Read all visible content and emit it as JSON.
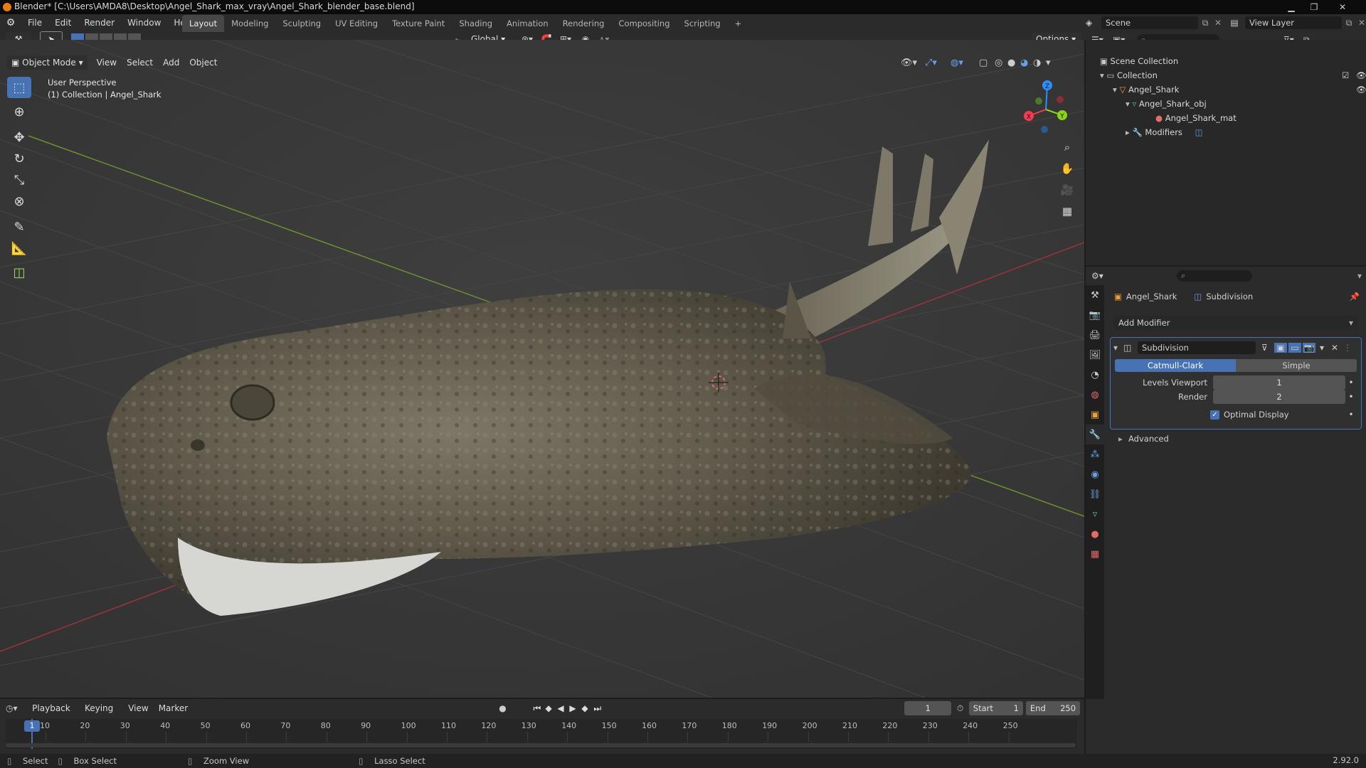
{
  "window": {
    "title": "Blender* [C:\\Users\\AMDA8\\Desktop\\Angel_Shark_max_vray\\Angel_Shark_blender_base.blend]"
  },
  "menu": [
    "File",
    "Edit",
    "Render",
    "Window",
    "Help"
  ],
  "workspaces": {
    "active": "Layout",
    "tabs": [
      "Layout",
      "Modeling",
      "Sculpting",
      "UV Editing",
      "Texture Paint",
      "Shading",
      "Animation",
      "Rendering",
      "Compositing",
      "Scripting"
    ],
    "add": "+"
  },
  "scene": {
    "label": "Scene"
  },
  "view_layer": {
    "label": "View Layer"
  },
  "toolbar_header": {
    "transform_orientation": "Global",
    "options": "Options"
  },
  "viewport": {
    "mode": "Object Mode",
    "menus": [
      "View",
      "Select",
      "Add",
      "Object"
    ],
    "overlay_line1": "User Perspective",
    "overlay_line2": "(1) Collection | Angel_Shark",
    "gizmo": {
      "x": "X",
      "y": "Y",
      "z": "Z"
    }
  },
  "outliner": {
    "scene_collection": "Scene Collection",
    "collection": "Collection",
    "object": "Angel_Shark",
    "mesh": "Angel_Shark_obj",
    "material": "Angel_Shark_mat",
    "modifiers": "Modifiers"
  },
  "properties": {
    "object_name": "Angel_Shark",
    "modifier_crumb": "Subdivision",
    "add_modifier": "Add Modifier",
    "modifier": {
      "name": "Subdivision",
      "mode_catmull": "Catmull-Clark",
      "mode_simple": "Simple",
      "active_mode": "Catmull-Clark",
      "levels_viewport_label": "Levels Viewport",
      "levels_viewport": "1",
      "render_label": "Render",
      "render": "2",
      "optimal_display_label": "Optimal Display",
      "optimal_display": true,
      "advanced": "Advanced"
    }
  },
  "timeline": {
    "menus": [
      "Playback",
      "Keying",
      "View",
      "Marker"
    ],
    "current_frame": "1",
    "start_label": "Start",
    "start": "1",
    "end_label": "End",
    "end": "250",
    "ticks": [
      "10",
      "20",
      "30",
      "40",
      "50",
      "60",
      "70",
      "80",
      "90",
      "100",
      "110",
      "120",
      "130",
      "140",
      "150",
      "160",
      "170",
      "180",
      "190",
      "200",
      "210",
      "220",
      "230",
      "240",
      "250"
    ],
    "playhead": "1"
  },
  "statusbar": {
    "select": "Select",
    "box_select": "Box Select",
    "zoom_view": "Zoom View",
    "lasso_select": "Lasso Select",
    "version": "2.92.0"
  },
  "colors": {
    "accent": "#4772b3",
    "x_axis": "#f73a4f",
    "y_axis": "#8ad41b",
    "z_axis": "#2c8fff",
    "blender_orange": "#e87d0d"
  }
}
